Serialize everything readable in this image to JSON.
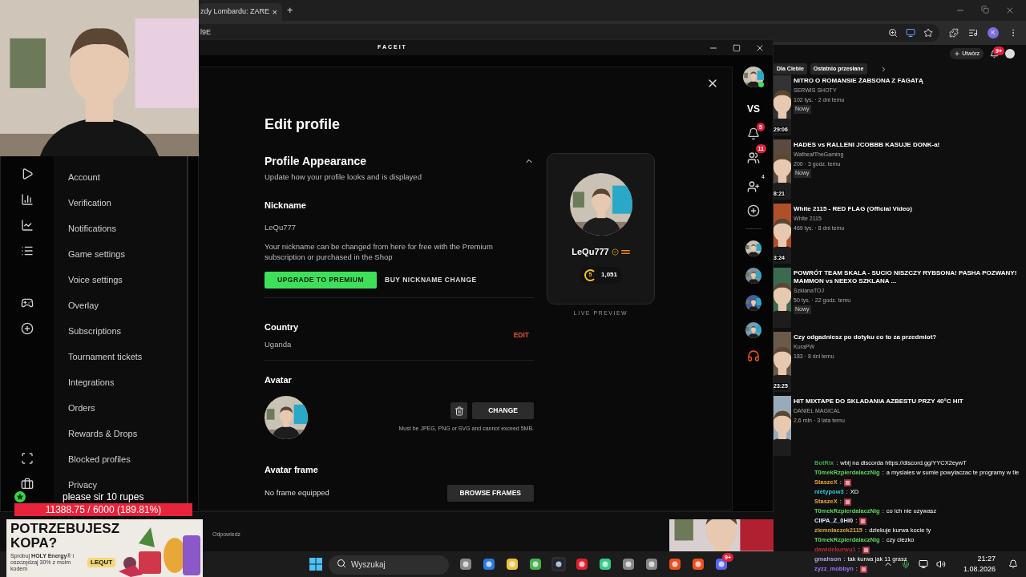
{
  "browser": {
    "tab_title": "zdy Lombardu: ZARE",
    "tab_close": "×",
    "new_tab": "+",
    "address": "l9E",
    "profile_initial": "K"
  },
  "faceit": {
    "title": "FACEIT",
    "settings_menu": [
      "Account",
      "Verification",
      "Notifications",
      "Game settings",
      "Voice settings",
      "Overlay",
      "Subscriptions",
      "Tournament tickets",
      "Integrations",
      "Orders",
      "Rewards & Drops",
      "Blocked profiles",
      "Privacy"
    ],
    "modal": {
      "heading": "Edit profile",
      "section": {
        "title": "Profile Appearance",
        "subtitle": "Update how your profile looks and is displayed",
        "expanded": true
      },
      "nickname": {
        "label": "Nickname",
        "value": "LeQu777",
        "note": "Your nickname can be changed from here for free with the Premium subscription or purchased in the Shop",
        "primary_button": "UPGRADE TO PREMIUM",
        "secondary_button": "BUY NICKNAME CHANGE"
      },
      "country": {
        "label": "Country",
        "value": "Uganda",
        "edit": "EDIT"
      },
      "avatar": {
        "label": "Avatar",
        "change_button": "CHANGE",
        "hint": "Must be JPEG, PNG or SVG and cannot exceed 5MB."
      },
      "avatar_frame": {
        "label": "Avatar frame",
        "value": "No frame equipped",
        "button": "BROWSE FRAMES"
      },
      "preview": {
        "nickname": "LeQu777",
        "level": "5",
        "elo": "1,051",
        "caption": "LIVE PREVIEW"
      }
    },
    "right_rail": {
      "vs": "VS",
      "notifications_badge": "5",
      "friends_badge": "11",
      "party_badge": "4"
    }
  },
  "youtube": {
    "create_button": "Utwórz",
    "notifications_badge": "9+",
    "chips": [
      {
        "label": "Dla Ciebie",
        "selected": false
      },
      {
        "label": "Ostatnio przesłane",
        "selected": false
      }
    ],
    "videos": [
      {
        "title": "NITRO O ROMANSIE ŻABSONA Z FAGATĄ",
        "channel": "SERWIS SHOTY",
        "meta": "102 tys. · 2 dni temu",
        "badge": "Nowy",
        "duration": "29:06"
      },
      {
        "title": "HADES vs RALLENI JCOBBB KASUJE DONK-a!",
        "channel": "WatheafTheGaming",
        "meta": "200 · 3 godz. temu",
        "badge": "Nowy",
        "duration": "8:21"
      },
      {
        "title": "White 2115 - RED FLAG (Official Video)",
        "channel": "White 2115",
        "meta": "469 tys. · 8 dni temu",
        "duration": "3:24"
      },
      {
        "title": "POWRÓT TEAM SKALA - SUCIO NISZCZY RYBSONA! PASHA POZWANY! MAMMON vs NEEXO SZKLANA ...",
        "channel": "SzklanaTOJ",
        "meta": "50 tys. · 22 godz. temu",
        "badge": "Nowy"
      },
      {
        "title": "Czy odgadniesz po dotyku co to za przedmiot?",
        "channel": "KuraPW",
        "meta": "183 · 8 dni temu",
        "duration": "23:25"
      },
      {
        "title": "HIT MIXTAPE DO SKLADANIA AZBESTU PRZY 40°C HIT",
        "channel": "DANIEL MAGICAL",
        "meta": "2,6 mln · 3 lata temu"
      }
    ],
    "reply_link": "Odpowiedz"
  },
  "stream_overlay": {
    "donation_text": "please sir 10 rupes",
    "goal": {
      "reading": "11388.75 / 6000 (189.81%)",
      "level": 1
    },
    "ad": {
      "headline": "POTRZEBUJESZ KOPA?",
      "text": "Spróbuj **HOLY Energy**® i oszczędzaj 30% z moim kodem",
      "code": "LEQUT"
    },
    "chat_separator": ":",
    "chat": [
      {
        "user": "BotRix",
        "color": "#3fa34d",
        "text": "wbij na discorda https://discord.gg/YYCX2eywT"
      },
      {
        "user": "T0mekRzpierdalaczNig",
        "color": "#5fd35f",
        "text": "a myslales w sumie powylaczac te programy w tle"
      },
      {
        "user": "StaszeX",
        "color": "#e8a33a",
        "kind": "emote"
      },
      {
        "user": "nietypow3",
        "color": "#2fc8d8",
        "text": "XD"
      },
      {
        "user": "StaszeX",
        "color": "#e8a33a",
        "kind": "emote"
      },
      {
        "user": "T0mekRzpierdalaczNig",
        "color": "#5fd35f",
        "text": "co ich nie uzywasz"
      },
      {
        "user": "CIIPA_Z_0HI0",
        "color": "#dfe6ff",
        "kind": "emote"
      },
      {
        "user": "ziemniaczek2115",
        "color": "#d6a44a",
        "text": "dziekuje kurwa kocie ty"
      },
      {
        "user": "T0mekRzpierdalaczNig",
        "color": "#5fd35f",
        "text": "czy ciezko"
      },
      {
        "user": "dawidekurwu1",
        "color": "#c0283a",
        "kind": "emote"
      },
      {
        "user": "gmahson",
        "color": "#b9a0e0",
        "text": "tak kurwa jak 11 grasz"
      },
      {
        "user": "zyzz_mobbyn",
        "color": "#a070ff",
        "kind": "emote"
      }
    ]
  },
  "taskbar": {
    "search_placeholder": "Wyszukaj",
    "discord_badge": "9+",
    "time": "21:27",
    "date": "1.08.2026"
  }
}
